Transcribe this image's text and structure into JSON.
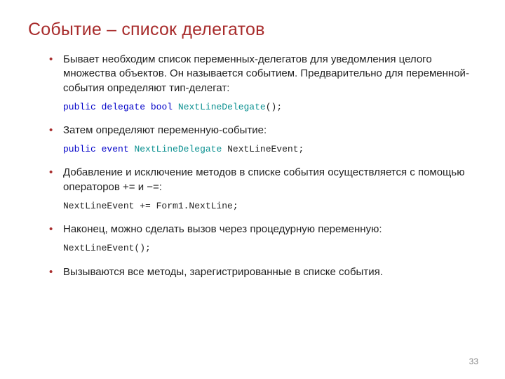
{
  "title": "Событие – список делегатов",
  "bullets": [
    {
      "text": "Бывает необходим список переменных-делегатов для уведомления целого множества объектов. Он называется событием. Предварительно для переменной-события определяют тип-делегат:",
      "code": [
        {
          "t": "public",
          "c": "kw"
        },
        {
          "t": " ",
          "c": "plain"
        },
        {
          "t": "delegate",
          "c": "kw"
        },
        {
          "t": " ",
          "c": "plain"
        },
        {
          "t": "bool",
          "c": "kw"
        },
        {
          "t": " ",
          "c": "plain"
        },
        {
          "t": "NextLineDelegate",
          "c": "type"
        },
        {
          "t": "();",
          "c": "plain"
        }
      ]
    },
    {
      "text": "Затем определяют переменную-событие:",
      "code": [
        {
          "t": "public",
          "c": "kw"
        },
        {
          "t": " ",
          "c": "plain"
        },
        {
          "t": "event",
          "c": "kw"
        },
        {
          "t": " ",
          "c": "plain"
        },
        {
          "t": "NextLineDelegate",
          "c": "type"
        },
        {
          "t": " ",
          "c": "plain"
        },
        {
          "t": "NextLineEvent;",
          "c": "plain"
        }
      ]
    },
    {
      "text": "Добавление и исключение методов в списке события осуществляется с помощью операторов += и −=:",
      "code": [
        {
          "t": "NextLineEvent += Form1.NextLine;",
          "c": "plain"
        }
      ]
    },
    {
      "text": "Наконец, можно сделать вызов через процедурную переменную:",
      "code": [
        {
          "t": "NextLineEvent();",
          "c": "plain"
        }
      ]
    },
    {
      "text": "Вызываются все методы, зарегистрированные в списке события."
    }
  ],
  "page_number": "33",
  "colors": {
    "accent": "#a82c2c",
    "keyword": "#0000c8",
    "typeName": "#0a9090"
  }
}
